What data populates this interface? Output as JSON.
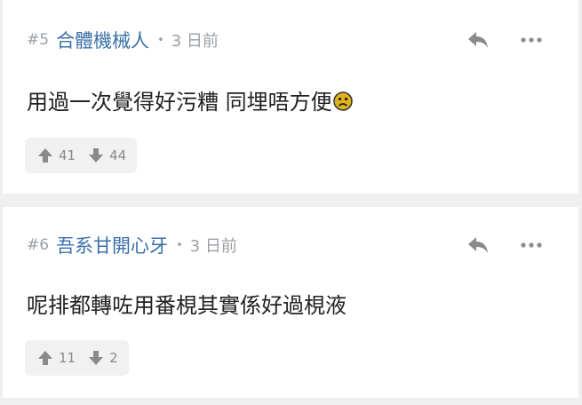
{
  "comments": [
    {
      "floor": "#5",
      "author": "合體機械人",
      "separator": "•",
      "time": "3 日前",
      "text": "用過一次覺得好污糟 同埋唔方便",
      "emoji": "sad-face-icon",
      "upvotes": "41",
      "downvotes": "44"
    },
    {
      "floor": "#6",
      "author": "吾系甘開心牙",
      "separator": "•",
      "time": "3 日前",
      "text": "呢排都轉咗用番梘其實係好過梘液",
      "upvotes": "11",
      "downvotes": "2"
    }
  ],
  "colors": {
    "author": "#3a70a8",
    "meta": "#9aa0a6",
    "text": "#222222",
    "vote_bg": "#f1f1f1",
    "page_bg": "#efefef"
  }
}
